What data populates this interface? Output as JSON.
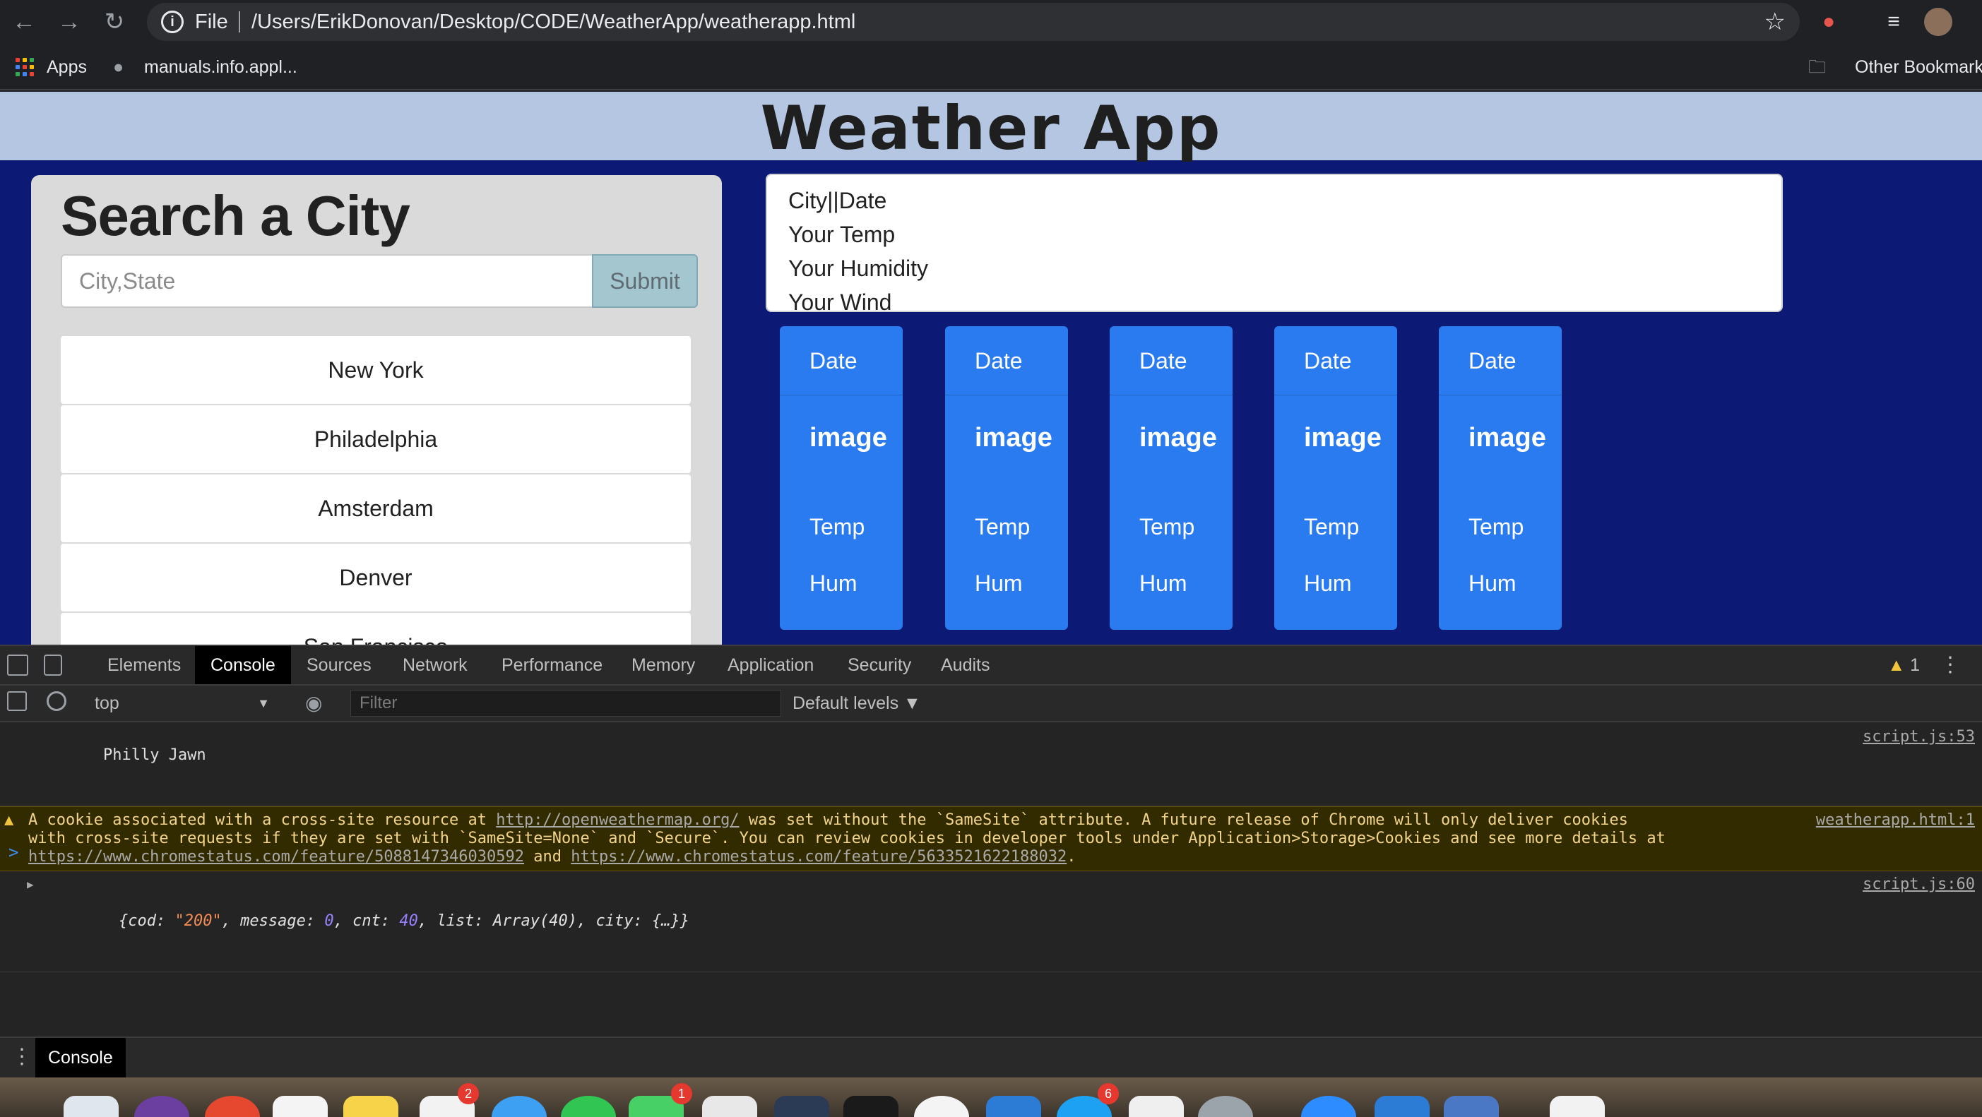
{
  "browser": {
    "scheme": "File",
    "url": "/Users/ErikDonovan/Desktop/CODE/WeatherApp/weatherapp.html",
    "bookmarks": [
      {
        "label": "Apps",
        "icon": "apps-grid-icon"
      },
      {
        "label": "manuals.info.appl...",
        "icon": "apple-icon"
      }
    ],
    "other_bookmarks": "Other Bookmarks"
  },
  "app": {
    "title": "Weather App",
    "search": {
      "title": "Search a City",
      "placeholder": "City,State",
      "submit_label": "Submit"
    },
    "cities": [
      "New York",
      "Philadelphia",
      "Amsterdam",
      "Denver",
      "San Francisco"
    ],
    "current": {
      "city_date": "City||Date",
      "temp": "Your Temp",
      "humidity": "Your Humidity",
      "wind": "Your Wind"
    },
    "forecast": [
      {
        "date": "Date",
        "image": "image",
        "temp": "Temp",
        "hum": "Hum"
      },
      {
        "date": "Date",
        "image": "image",
        "temp": "Temp",
        "hum": "Hum"
      },
      {
        "date": "Date",
        "image": "image",
        "temp": "Temp",
        "hum": "Hum"
      },
      {
        "date": "Date",
        "image": "image",
        "temp": "Temp",
        "hum": "Hum"
      },
      {
        "date": "Date",
        "image": "image",
        "temp": "Temp",
        "hum": "Hum"
      }
    ]
  },
  "devtools": {
    "tabs": [
      "Elements",
      "Console",
      "Sources",
      "Network",
      "Performance",
      "Memory",
      "Application",
      "Security",
      "Audits"
    ],
    "active_tab": "Console",
    "warning_count": "1",
    "context": "top",
    "filter_placeholder": "Filter",
    "levels": "Default levels ▼",
    "messages": {
      "log1": {
        "text": "Philly Jawn",
        "source": "script.js:53"
      },
      "warn": {
        "t1": "A cookie associated with a cross-site resource at ",
        "l1": "http://openweathermap.org/",
        "t2": " was set without the `SameSite` attribute. A future release of Chrome will only deliver cookies with cross-site requests if they are set with `SameSite=None` and `Secure`. You can review cookies in developer tools under Application>Storage>Cookies and see more details at ",
        "l2": "https://www.chromestatus.com/feature/5088147346030592",
        "t3": " and ",
        "l3": "https://www.chromestatus.com/feature/5633521622188032",
        "t4": ".",
        "source": "weatherapp.html:1"
      },
      "obj": {
        "p1": "{cod: ",
        "cod": "\"200\"",
        "p2": ", message: ",
        "message": "0",
        "p3": ", cnt: ",
        "cnt": "40",
        "p4": ", list: Array(40), city: {…}}",
        "source": "script.js:60"
      }
    },
    "prompt": ">",
    "drawer_tab": "Console"
  },
  "dock": {
    "badges": [
      "2",
      "1",
      "6"
    ]
  }
}
